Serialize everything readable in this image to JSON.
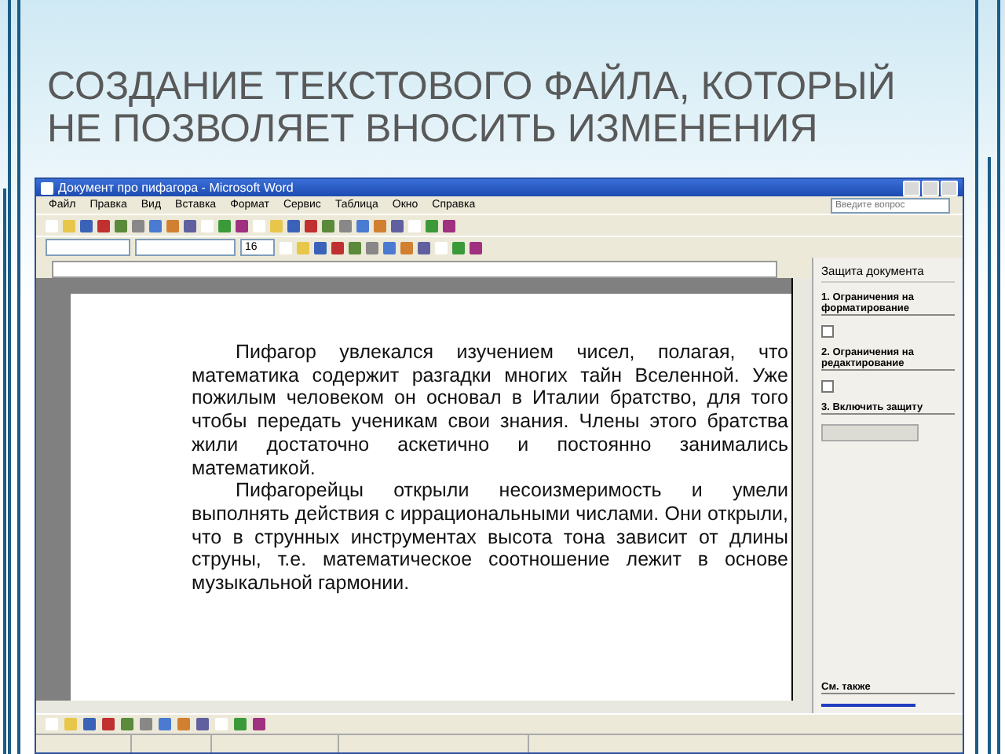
{
  "slide": {
    "title": "СОЗДАНИЕ ТЕКСТОВОГО ФАЙЛА, КОТОРЫЙ НЕ ПОЗВОЛЯЕТ ВНОСИТЬ ИЗМЕНЕНИЯ"
  },
  "window": {
    "title": "Документ про пифагора - Microsoft Word"
  },
  "menu": [
    "Файл",
    "Правка",
    "Вид",
    "Вставка",
    "Формат",
    "Сервис",
    "Таблица",
    "Окно",
    "Справка"
  ],
  "help": {
    "placeholder": "Введите вопрос"
  },
  "format_bar": {
    "size": "16"
  },
  "document": {
    "paragraphs": [
      "Пифагор увлекался изучением чисел, полагая, что математика содержит разгадки многих тайн Вселенной. Уже пожилым человеком он основал в Италии братство, для того чтобы передать ученикам свои знания. Члены этого братства жили достаточно аскетично и постоянно занимались математикой.",
      "Пифагорейцы открыли несоизмеримость и умели выполнять действия с иррациональными числами. Они открыли, что в струнных инструментах высота тона зависит от длины струны, т.е. математическое соотношение лежит в основе музыкальной гармонии."
    ]
  },
  "task_pane": {
    "title": "Защита документа",
    "sections": [
      {
        "heading": "1. Ограничения на форматирование",
        "kind": "checkbox",
        "checked": false
      },
      {
        "heading": "2. Ограничения на редактирование",
        "kind": "checkbox",
        "checked": false
      },
      {
        "heading": "3. Включить защиту",
        "kind": "button"
      },
      {
        "heading": "См. также",
        "kind": "link"
      }
    ]
  }
}
